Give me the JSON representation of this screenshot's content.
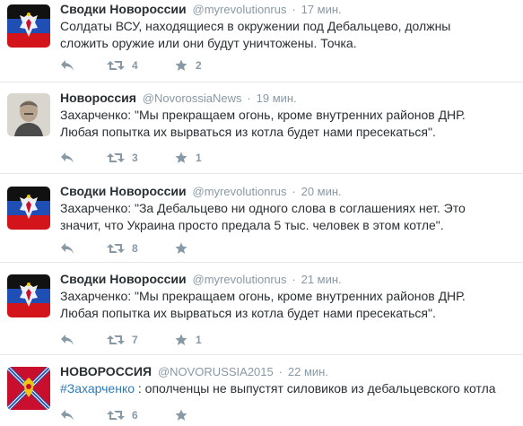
{
  "tweets": [
    {
      "fullname": "Сводки Новороссии",
      "username": "@myrevolutionrus",
      "separator": "·",
      "time": "17 мин.",
      "hashtag": "",
      "text": "Солдаты ВСУ, находящиеся в окружении под Дебальцево, должны\nсложить оружие или они будут уничтожены. Точка.",
      "retweets": "4",
      "favorites": "2",
      "avatar": "dpr-flag-emblem"
    },
    {
      "fullname": "Новороссия",
      "username": "@NovorossiaNews",
      "separator": "·",
      "time": "19 мин.",
      "hashtag": "",
      "text": "Захарченко: \"Мы прекращаем огонь, кроме внутренних районов ДНР.\nЛюбая попытка их вырваться из котла будет нами пресекаться\".",
      "retweets": "3",
      "favorites": "1",
      "avatar": "man-portrait"
    },
    {
      "fullname": "Сводки Новороссии",
      "username": "@myrevolutionrus",
      "separator": "·",
      "time": "20 мин.",
      "hashtag": "",
      "text": "Захарченко: \"За Дебальцево ни одного слова в соглашениях нет. Это\nзначит, что Украина просто предала 5 тыс. человек в этом котле\".",
      "retweets": "8",
      "favorites": "",
      "avatar": "dpr-flag-emblem"
    },
    {
      "fullname": "Сводки Новороссии",
      "username": "@myrevolutionrus",
      "separator": "·",
      "time": "21 мин.",
      "hashtag": "",
      "text": "Захарченко: \"Мы прекращаем огонь, кроме внутренних районов ДНР.\nЛюбая попытка их вырваться из котла будет нами пресекаться\".",
      "retweets": "7",
      "favorites": "1",
      "avatar": "dpr-flag-emblem"
    },
    {
      "fullname": "НОВОРОССИЯ",
      "username": "@NOVORUSSIA2015",
      "separator": "·",
      "time": "22 мин.",
      "hashtag": "#Захарченко",
      "text": " : ополченцы не выпустят силовиков из дебальцевского котла",
      "retweets": "6",
      "favorites": "",
      "avatar": "novorossia-flag"
    }
  ],
  "colors": {
    "name": "#292f33",
    "meta": "#8899a6",
    "hashtag": "#2b7bb9",
    "divider": "#e1e8ed"
  },
  "icons": {
    "reply": "reply-arrow-icon",
    "retweet": "retweet-icon",
    "favorite": "star-icon"
  }
}
